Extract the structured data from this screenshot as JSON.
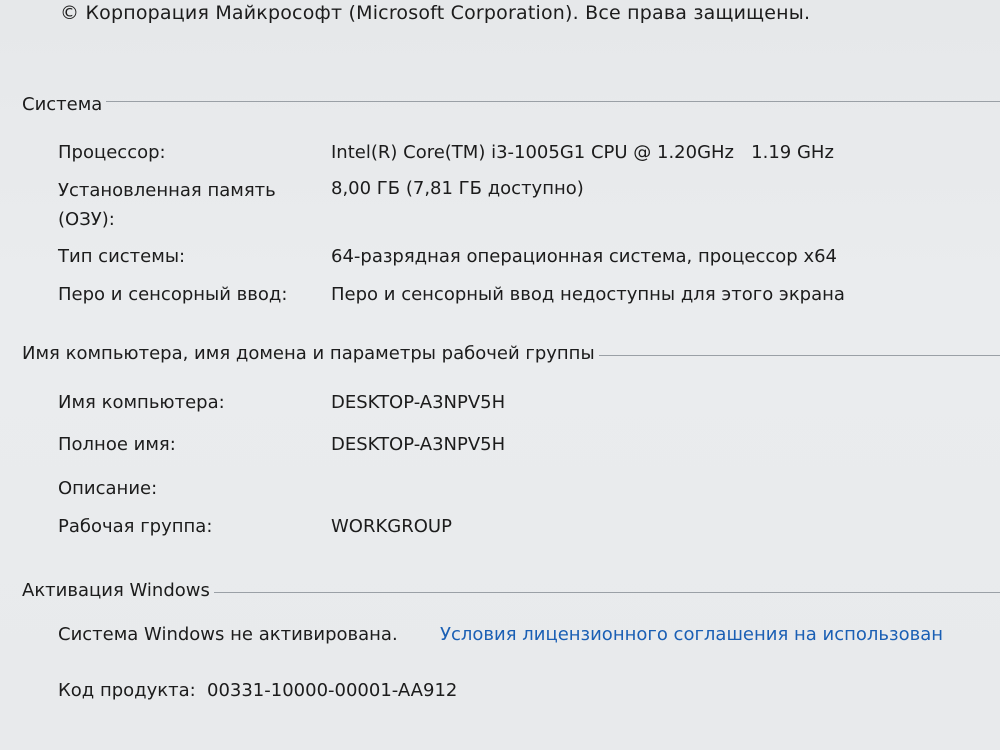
{
  "copyright": "© Корпорация Майкрософт (Microsoft Corporation). Все права защищены.",
  "system": {
    "title": "Система",
    "processor": {
      "label": "Процессор:",
      "value": "Intel(R) Core(TM) i3-1005G1 CPU @ 1.20GHz   1.19 GHz"
    },
    "memory": {
      "label_line1": "Установленная память",
      "label_line2": "(ОЗУ):",
      "value": "8,00 ГБ (7,81 ГБ доступно)"
    },
    "system_type": {
      "label": "Тип системы:",
      "value": "64-разрядная операционная система, процессор x64"
    },
    "pen_touch": {
      "label": "Перо и сенсорный ввод:",
      "value": "Перо и сенсорный ввод недоступны для этого экрана"
    }
  },
  "computer": {
    "title": "Имя компьютера, имя домена и параметры рабочей группы",
    "computer_name": {
      "label": "Имя компьютера:",
      "value": "DESKTOP-A3NPV5H"
    },
    "full_name": {
      "label": "Полное имя:",
      "value": "DESKTOP-A3NPV5H"
    },
    "description": {
      "label": "Описание:",
      "value": ""
    },
    "workgroup": {
      "label": "Рабочая группа:",
      "value": "WORKGROUP"
    }
  },
  "activation": {
    "title": "Активация Windows",
    "status": "Система Windows не активирована.",
    "license_link": "Условия лицензионного соглашения на использован",
    "product_key_label": "Код продукта:",
    "product_key_value": "00331-10000-00001-AA912"
  },
  "colors": {
    "link": "#1a5fb4",
    "text": "#1c1c1c",
    "background": "#e8eaec"
  }
}
